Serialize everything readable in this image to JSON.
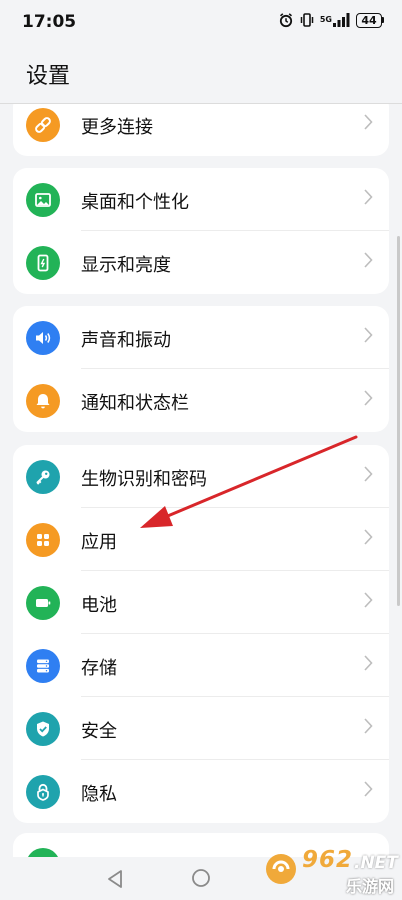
{
  "status_bar": {
    "time": "17:05",
    "network_label": "5G",
    "battery": "44",
    "icons": [
      "alarm-icon",
      "vibrate-icon",
      "signal-icon",
      "battery-icon"
    ]
  },
  "header": {
    "title": "设置"
  },
  "groups": [
    {
      "items": [
        {
          "label": "更多连接",
          "icon": "link-icon",
          "color": "#f59a23"
        }
      ]
    },
    {
      "items": [
        {
          "label": "桌面和个性化",
          "icon": "image-icon",
          "color": "#22b357"
        },
        {
          "label": "显示和亮度",
          "icon": "display-icon",
          "color": "#22b357"
        }
      ]
    },
    {
      "items": [
        {
          "label": "声音和振动",
          "icon": "speaker-icon",
          "color": "#2f7ff2"
        },
        {
          "label": "通知和状态栏",
          "icon": "bell-icon",
          "color": "#f59a23"
        }
      ]
    },
    {
      "items": [
        {
          "label": "生物识别和密码",
          "icon": "key-icon",
          "color": "#1fa3ad"
        },
        {
          "label": "应用",
          "icon": "apps-icon",
          "color": "#f59a23"
        },
        {
          "label": "电池",
          "icon": "battery-icon",
          "color": "#22b357"
        },
        {
          "label": "存储",
          "icon": "storage-icon",
          "color": "#2f7ff2"
        },
        {
          "label": "安全",
          "icon": "shield-icon",
          "color": "#1fa3ad"
        },
        {
          "label": "隐私",
          "icon": "lock-icon",
          "color": "#1fa3ad"
        }
      ]
    }
  ],
  "navigation": {
    "icons": [
      "back-icon",
      "home-icon"
    ]
  },
  "watermark": {
    "number": "962",
    "suffix": ".NET",
    "text": "乐游网"
  },
  "annotation": {
    "type": "arrow",
    "color": "#d8262a",
    "points_to": "应用"
  }
}
